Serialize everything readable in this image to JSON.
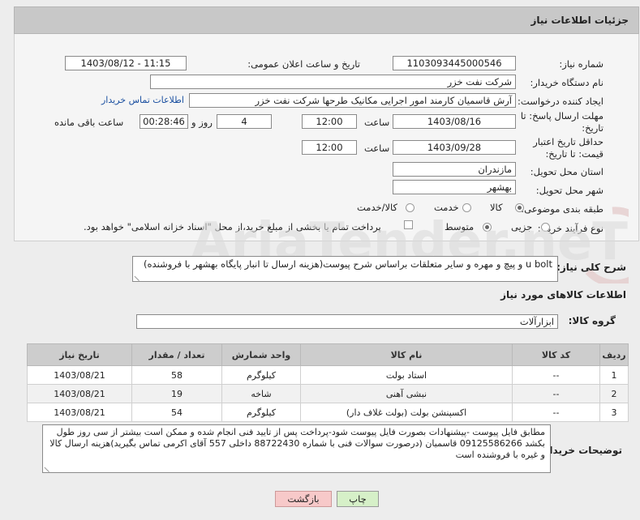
{
  "header": {
    "title": "جزئیات اطلاعات نیاز"
  },
  "fields": {
    "need_number_label": "شماره نیاز:",
    "need_number": "1103093445000546",
    "announce_label": "تاریخ و ساعت اعلان عمومی:",
    "announce_value": "1403/08/12 - 11:15",
    "buyer_org_label": "نام دستگاه خریدار:",
    "buyer_org": "شرکت نفت خزر",
    "creator_label": "ایجاد کننده درخواست:",
    "creator": "آرش قاسمیان کارمند امور اجرایی مکانیک طرحها شرکت نفت خزر",
    "contact_link": "اطلاعات تماس خریدار",
    "deadline_label": "مهلت ارسال پاسخ: تا تاریخ:",
    "deadline_date": "1403/08/16",
    "time_label": "ساعت",
    "deadline_time": "12:00",
    "days_value": "4",
    "days_label": "روز و",
    "remaining_time": "00:28:46",
    "remaining_label": "ساعت باقی مانده",
    "validity_label": "حداقل تاریخ اعتبار قیمت: تا تاریخ:",
    "validity_date": "1403/09/28",
    "validity_time": "12:00",
    "province_label": "استان محل تحویل:",
    "province": "مازندران",
    "city_label": "شهر محل تحویل:",
    "city": "بهشهر",
    "category_label": "طبقه بندی موضوعی:",
    "category_options": [
      "کالا",
      "خدمت",
      "کالا/خدمت"
    ],
    "process_label": "نوع فرآیند خرید :",
    "process_options": [
      "جزیی",
      "متوسط"
    ],
    "payment_note": "پرداخت تمام یا بخشی از مبلغ خرید،از محل \"اسناد خزانه اسلامی\" خواهد بود."
  },
  "summary": {
    "label": "شرح کلی نیاز:",
    "text": "u bolt و پیچ و مهره و سایر متعلقات براساس شرح پیوست(هزینه ارسال تا انبار پایگاه بهشهر با فروشنده)"
  },
  "goods": {
    "section_title": "اطلاعات کالاهای مورد نیاز",
    "group_label": "گروه کالا:",
    "group_value": "ابزارآلات"
  },
  "table": {
    "headers": [
      "ردیف",
      "کد کالا",
      "نام کالا",
      "واحد شمارش",
      "تعداد / مقدار",
      "تاریخ نیاز"
    ],
    "rows": [
      [
        "1",
        "--",
        "استاد بولت",
        "کیلوگرم",
        "58",
        "1403/08/21"
      ],
      [
        "2",
        "--",
        "نبشی آهنی",
        "شاخه",
        "19",
        "1403/08/21"
      ],
      [
        "3",
        "--",
        "اکسپنشن بولت (بولت غلاف دار)",
        "کیلوگرم",
        "54",
        "1403/08/21"
      ]
    ]
  },
  "notes": {
    "label": "توضیحات خریدار:",
    "text": "مطابق فایل پیوست -پیشنهادات بصورت فایل پیوست شود-پرداخت پس از تایید فنی انجام شده و ممکن است بیشتر از سی روز طول بکشد 09125586266 قاسمیان (درصورت سوالات فنی با شماره 88722430 داخلی 557 آقای اکرمی تماس بگیرید)هزینه ارسال کالا و غیره با فروشنده است"
  },
  "buttons": {
    "print": "چاپ",
    "back": "بازگشت"
  },
  "colors": {
    "header_bg": "#c8c8c8",
    "link": "#1a4fa0",
    "back_button": "#f7c9c9",
    "print_button": "#d6f0c8"
  }
}
